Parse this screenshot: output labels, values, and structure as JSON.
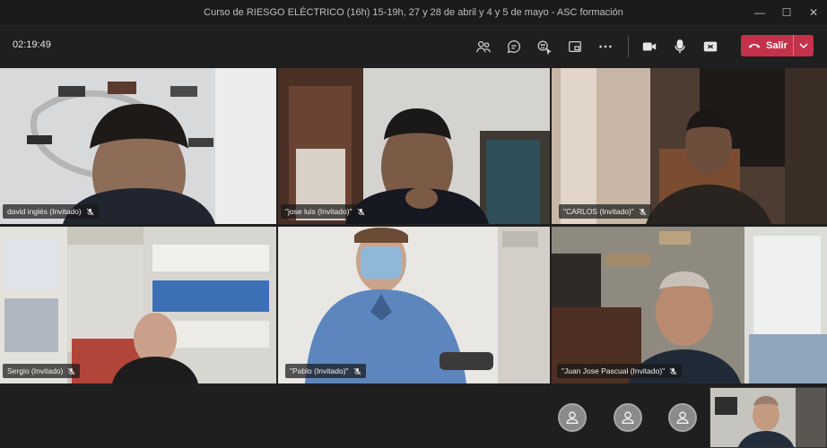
{
  "window": {
    "title": "Curso de RIESGO ELÉCTRICO (16h) 15-19h, 27 y 28 de abril y 4 y 5 de mayo - ASC formación",
    "controls": [
      "minimize-icon",
      "maximize-icon",
      "close-icon"
    ]
  },
  "toolbar": {
    "timer": "02:19:49",
    "icons": [
      "participants-icon",
      "chat-icon",
      "reactions-icon",
      "share-tray-icon",
      "more-options-icon",
      "camera-icon",
      "microphone-icon",
      "share-screen-icon"
    ],
    "leave_label": "Salir",
    "leave_color": "#c4314b"
  },
  "participants": [
    {
      "name": "david inglés (Invitado)",
      "muted": true
    },
    {
      "name": "\"jose luis (Invitado)\"",
      "muted": true
    },
    {
      "name": "\"CARLOS (Invitado)\"",
      "muted": true
    },
    {
      "name": "Sergio (Invitado)",
      "muted": true
    },
    {
      "name": "\"Pablo (Invitado)\"",
      "muted": true
    },
    {
      "name": "\"Juan Jose Pascual (Invitado)\"",
      "muted": true
    }
  ],
  "overflow_avatars": [
    "person-icon",
    "person-icon",
    "person-icon"
  ]
}
